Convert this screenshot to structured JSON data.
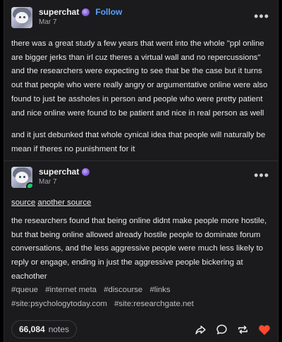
{
  "post1": {
    "username": "superchat",
    "badge_icon": "purple-badge-icon",
    "follow_label": "Follow",
    "date": "Mar 7",
    "more_icon": "more-options-icon",
    "paragraphs": [
      "there was a great study a few years that went into the whole \"ppl online are bigger jerks than irl cuz theres a virtual wall and no repercussions\" and the researchers were expecting to see that be the case but it turns out that people who were really angry or argumentative online were also found to just be assholes in person and people who were pretty patient and nice online were found to be patient and nice in real person as well",
      "and it just debunked that whole cynical idea that people will naturally be mean if theres no punishment for it"
    ]
  },
  "post2": {
    "username": "superchat",
    "badge_icon": "purple-badge-icon",
    "date": "Mar 7",
    "more_icon": "more-options-icon",
    "links": [
      "source",
      "another source"
    ],
    "paragraph": "the researchers found that being online didnt make people more hostile, but that being online allowed already hostile people to dominate forum conversations, and the less aggressive people were much less likely to reply or engage, ending in just the aggressive people bickering at eachother"
  },
  "tags": [
    "#queue",
    "#internet meta",
    "#discourse",
    "#links",
    "#site:psychologytoday.com",
    "#site:researchgate.net"
  ],
  "footer": {
    "notes_count": "66,084",
    "notes_label": "notes",
    "icons": [
      "share-icon",
      "reply-icon",
      "reblog-icon",
      "like-icon"
    ],
    "like_color": "#ff4930"
  },
  "colors": {
    "background": "#1b1b1d",
    "follow": "#55a3ff",
    "online_dot": "#18c96b"
  }
}
